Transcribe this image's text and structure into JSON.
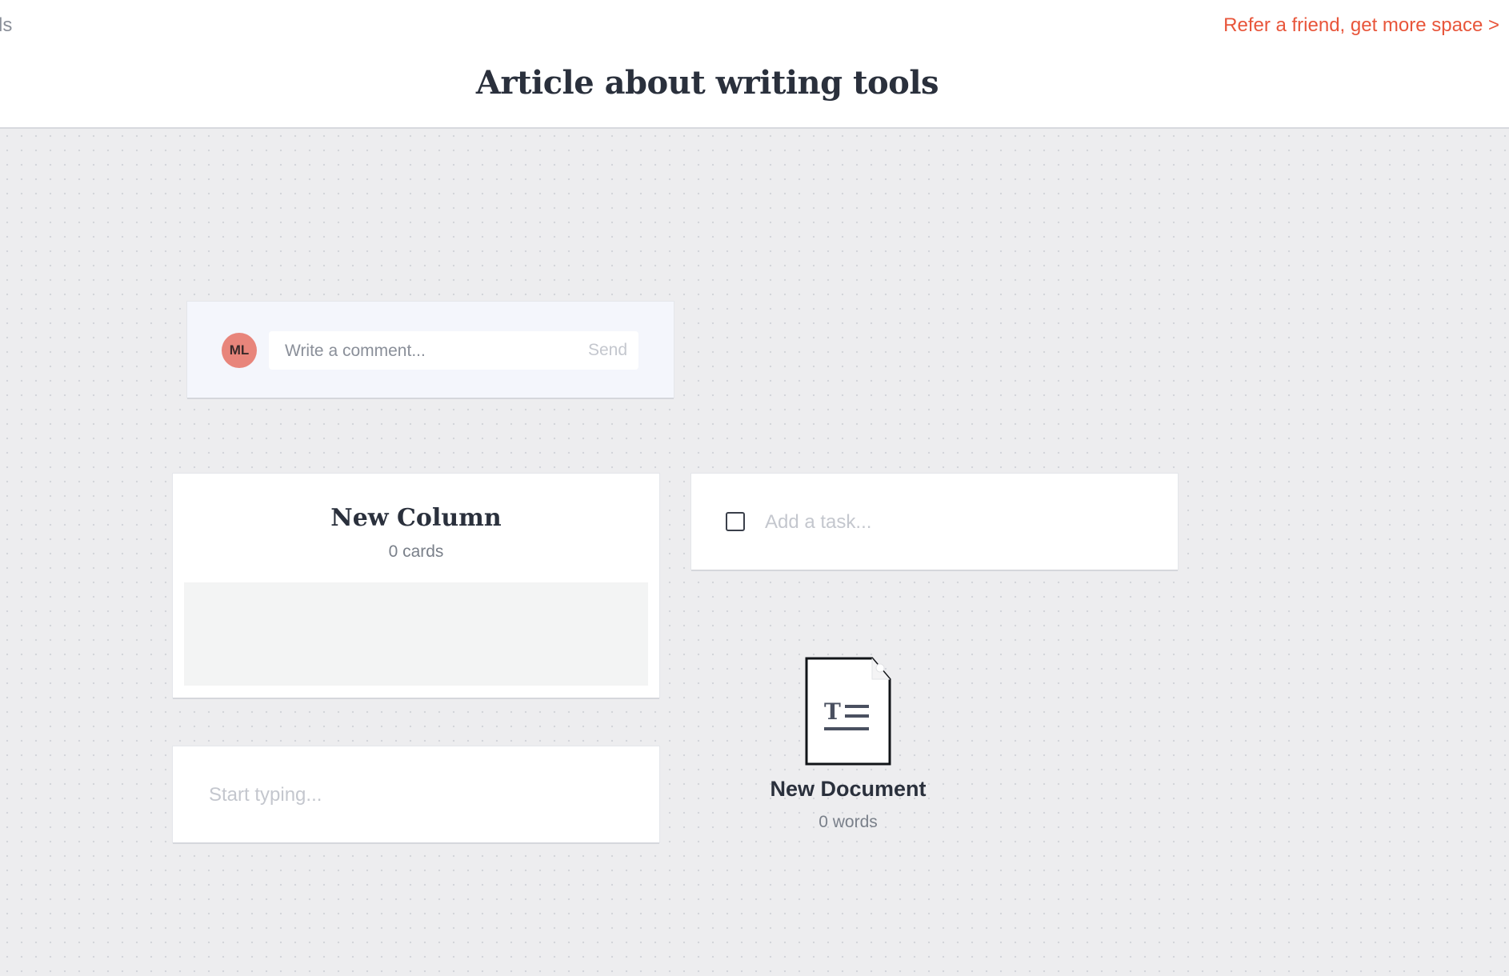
{
  "header": {
    "crumb_fragment": "ls",
    "refer_link": "Refer a friend, get more space >",
    "board_title": "Article about writing tools"
  },
  "comment": {
    "avatar_initials": "ML",
    "placeholder": "Write a comment...",
    "send_label": "Send"
  },
  "column": {
    "title": "New Column",
    "count": "0 cards"
  },
  "task": {
    "placeholder": "Add a task..."
  },
  "note": {
    "placeholder": "Start typing..."
  },
  "document": {
    "title": "New Document",
    "words": "0 words",
    "icon": "text-document-icon"
  },
  "colors": {
    "accent": "#e8553a",
    "avatar": "#e8857b",
    "title_text": "#2a303c",
    "canvas_bg": "#ededef"
  }
}
